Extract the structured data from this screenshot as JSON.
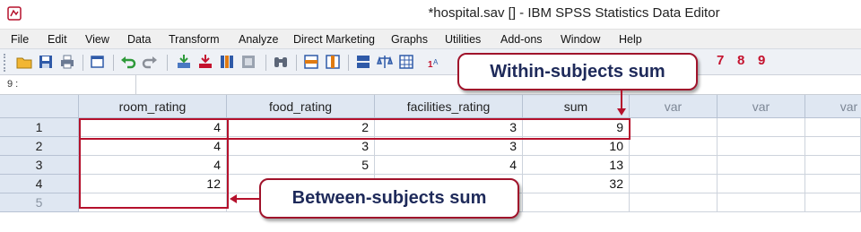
{
  "window": {
    "title": "*hospital.sav [] - IBM SPSS Statistics Data Editor"
  },
  "menubar": {
    "items": [
      "File",
      "Edit",
      "View",
      "Data",
      "Transform",
      "Analyze",
      "Direct Marketing",
      "Graphs",
      "Utilities",
      "Add-ons",
      "Window",
      "Help"
    ]
  },
  "toolbar": {
    "icons": [
      "open-icon",
      "save-icon",
      "print-icon",
      "dialog-recall-icon",
      "undo-icon",
      "redo-icon",
      "goto-case-icon",
      "goto-variable-icon",
      "variables-icon",
      "run-descriptives-icon",
      "find-icon",
      "insert-cases-icon",
      "insert-variable-icon",
      "split-file-icon",
      "weight-cases-icon",
      "select-cases-icon",
      "value-labels-icon"
    ],
    "numbers": [
      "7",
      "8",
      "9"
    ]
  },
  "cell_editor": {
    "reference": "9 :"
  },
  "grid": {
    "columns": [
      "room_rating",
      "food_rating",
      "facilities_rating",
      "sum",
      "var",
      "var",
      "var"
    ],
    "rows": [
      {
        "num": "1",
        "cells": [
          "4",
          "2",
          "3",
          "9"
        ]
      },
      {
        "num": "2",
        "cells": [
          "4",
          "3",
          "3",
          "10"
        ]
      },
      {
        "num": "3",
        "cells": [
          "4",
          "5",
          "4",
          "13"
        ]
      },
      {
        "num": "4",
        "cells": [
          "12",
          "",
          "",
          "32"
        ]
      },
      {
        "num": "5",
        "cells": [
          "",
          "",
          "",
          ""
        ]
      }
    ]
  },
  "annotations": {
    "within": "Within-subjects sum",
    "between": "Between-subjects sum"
  },
  "colors": {
    "accent": "#b5112c",
    "callout_text": "#1e2a5a",
    "header_bg": "#dfe7f2"
  }
}
